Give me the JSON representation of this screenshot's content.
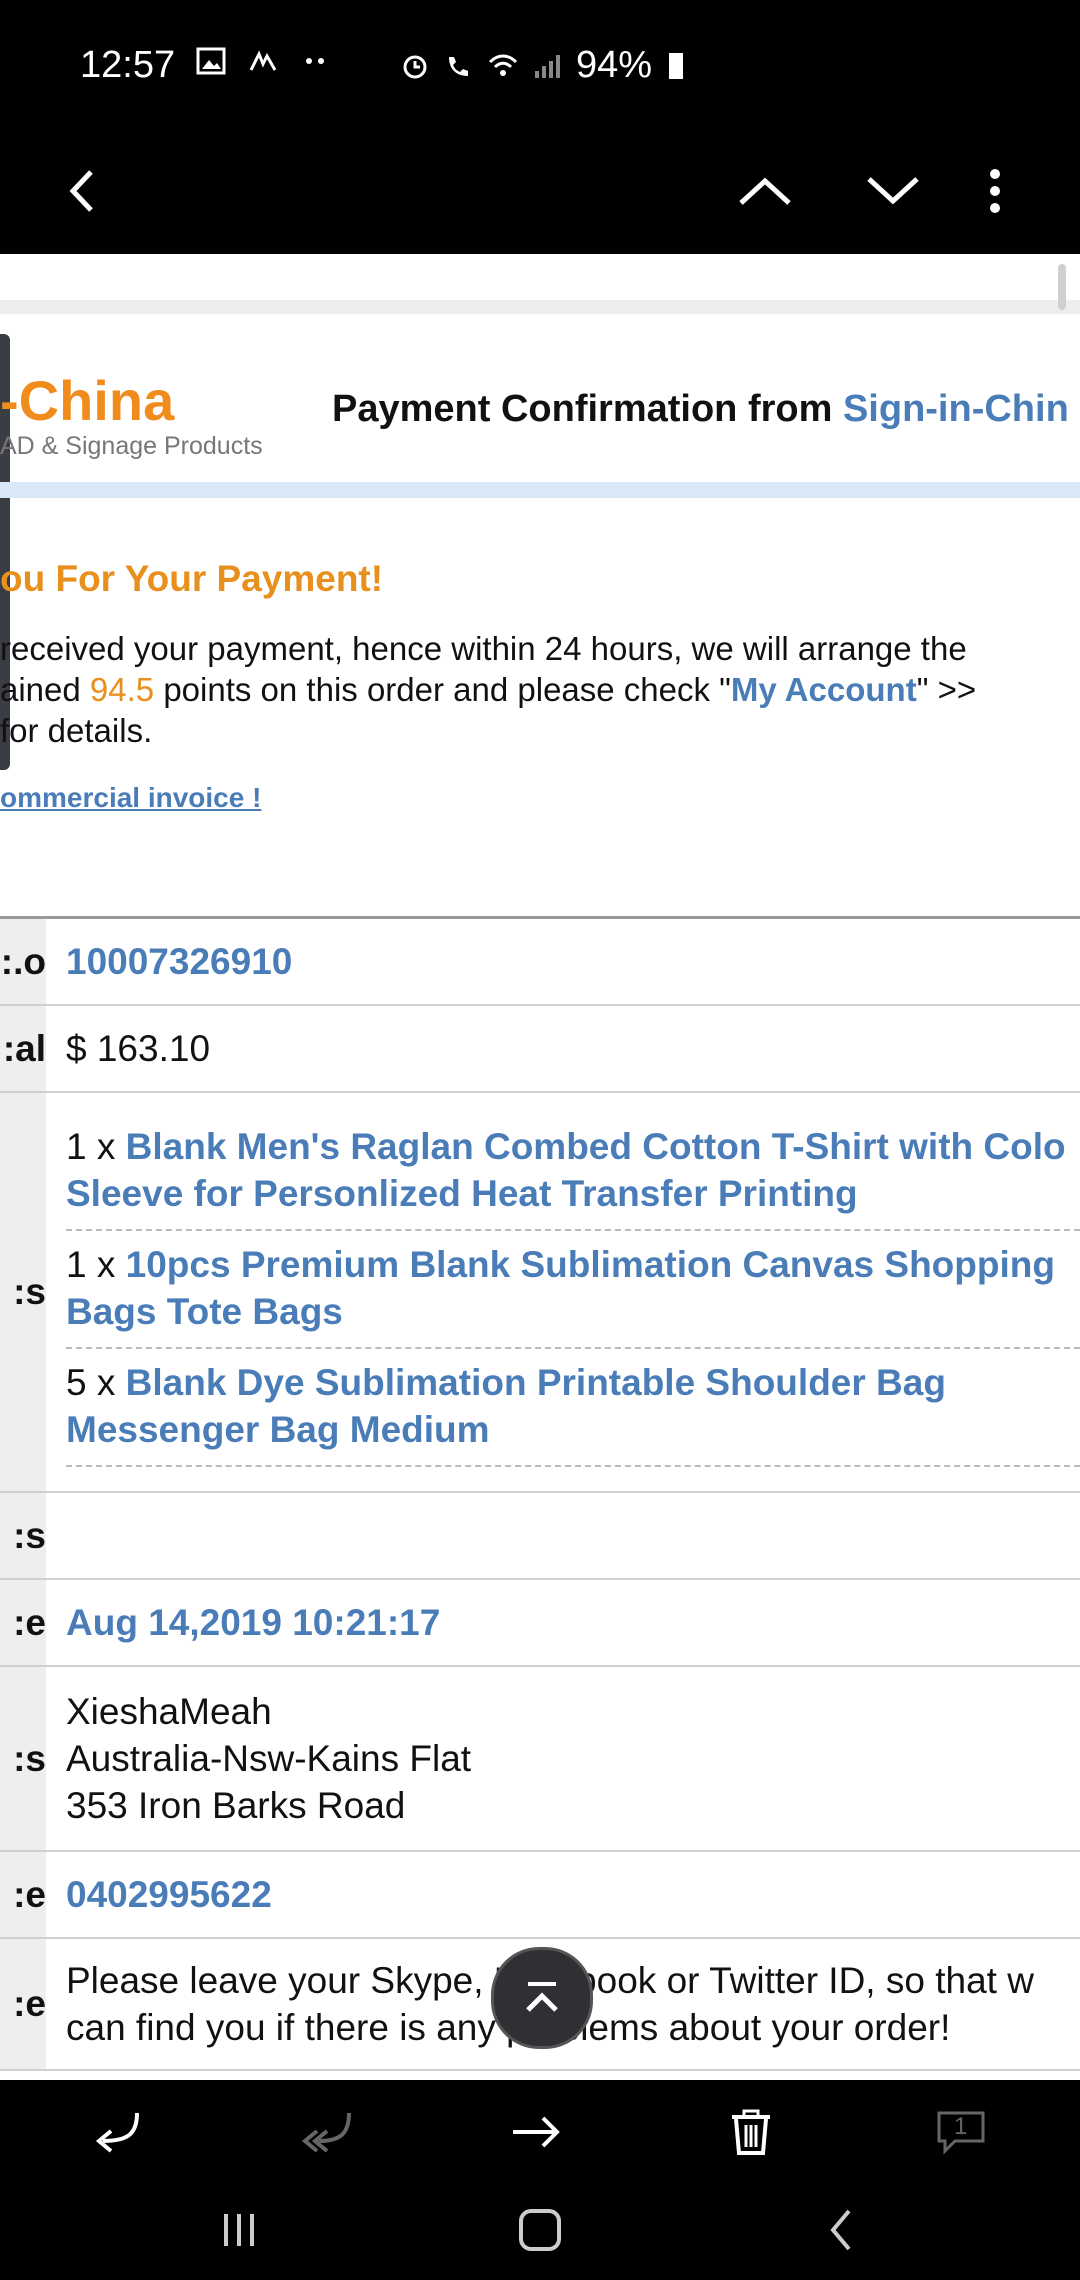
{
  "status_bar": {
    "time": "12:57",
    "battery": "94%",
    "left_icons": [
      "image-icon",
      "signal-logo-icon",
      "more-dots-icon"
    ],
    "right_icons": [
      "alarm-icon",
      "wifi-call-icon",
      "wifi-icon",
      "cell-signal-icon",
      "battery-icon"
    ]
  },
  "app_bar": {
    "back": "back-icon",
    "prev": "chevron-up-icon",
    "next": "chevron-down-icon",
    "menu": "more-vert-icon"
  },
  "email": {
    "logo_text": "-China",
    "logo_sub": "AD & Signage Products",
    "header_prefix": "Payment Confirmation from ",
    "header_brand": "Sign-in-Chin",
    "thanks": "ou For Your Payment!",
    "para_line1": " received your payment, hence within 24 hours, we will arrange the",
    "para_line2_pre": "ained ",
    "points": "94.5",
    "para_line2_mid": " points on this order and please check \"",
    "account_link": "My Account",
    "para_line2_post": "\" >>",
    "para_line3": " for details.",
    "invoice_link": "ommercial invoice !"
  },
  "order": {
    "rows": {
      "order_no": {
        "label": "o.:",
        "value": "10007326910"
      },
      "total": {
        "label": "al:",
        "value": "$ 163.10"
      },
      "items": {
        "label": "s:",
        "list": [
          {
            "qty": "1 x ",
            "line1": "Blank Men's Raglan Combed Cotton T-Shirt with Colo",
            "line2": "Sleeve for Personlized Heat Transfer Printing"
          },
          {
            "qty": "1 x ",
            "line1": "10pcs Premium Blank Sublimation Canvas Shopping",
            "line2": "Bags Tote Bags"
          },
          {
            "qty": "5 x ",
            "line1": "Blank Dye Sublimation Printable Shoulder Bag",
            "line2": "Messenger Bag Medium"
          }
        ]
      },
      "remarks": {
        "label": "s:",
        "value": ""
      },
      "date": {
        "label": "e:",
        "value": "Aug 14,2019 10:21:17"
      },
      "address": {
        "label": "s:",
        "lines": [
          "XieshaMeah",
          "Australia-Nsw-Kains Flat",
          "353 Iron Barks Road"
        ]
      },
      "phone": {
        "label": "e:",
        "value": "0402995622"
      },
      "note": {
        "label": "e:",
        "line1": "Please leave your Skype, Facebook or Twitter ID, so that w",
        "line2": "can find you if there is any problems about your order!"
      }
    }
  },
  "fab": "scroll-to-top-icon",
  "toolbar": [
    "reply-icon",
    "reply-all-icon",
    "forward-icon",
    "delete-icon",
    "message-count-icon"
  ],
  "toolbar_badge": "1",
  "navbar": [
    "recents-icon",
    "home-icon",
    "back-nav-icon"
  ]
}
